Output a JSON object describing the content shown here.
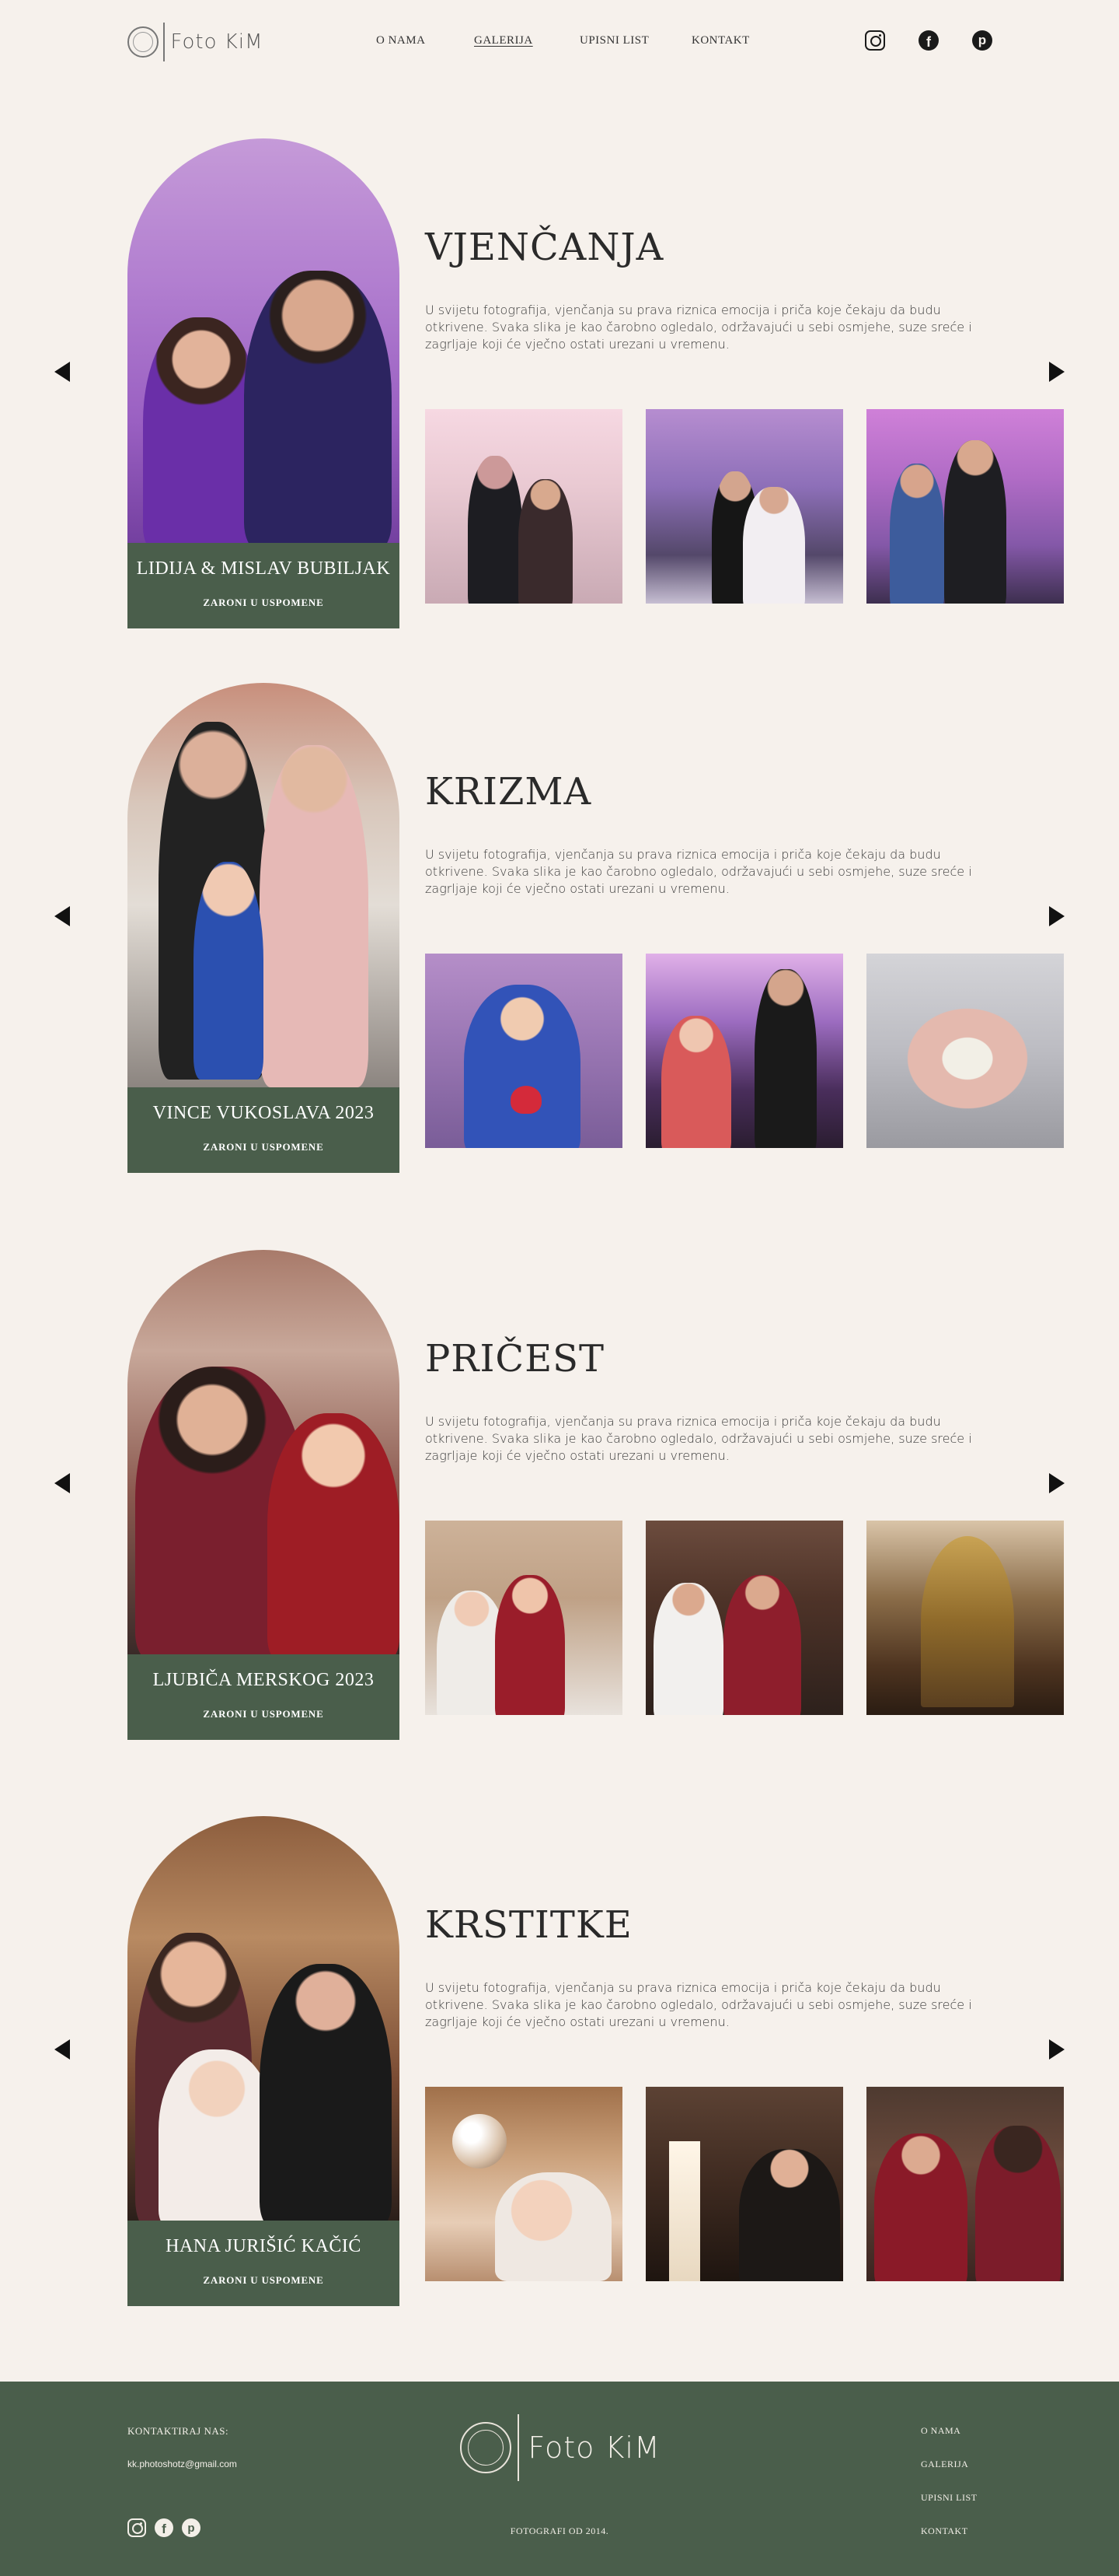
{
  "brand": {
    "name": "Foto KiM"
  },
  "nav": {
    "items": [
      "O NAMA",
      "GALERIJA",
      "UPISNI LIST",
      "KONTAKT"
    ],
    "active": "GALERIJA"
  },
  "social": [
    "instagram-icon",
    "facebook-icon",
    "pinterest-icon"
  ],
  "sections": [
    {
      "title": "VJENČANJA",
      "text": "U svijetu fotografija, vjenčanja su prava riznica emocija i priča koje čekaju da budu otkrivene. Svaka slika je kao čarobno ogledalo, održavajući u sebi osmjehe, suze sreće i zagrljaje koji će vječno ostati urezani u vremenu.",
      "featured": "LIDIJA & MISLAV BUBILJAK",
      "cta": "ZARONI U USPOMENE"
    },
    {
      "title": "KRIZMA",
      "text": "U svijetu fotografija, vjenčanja su prava riznica emocija i priča koje čekaju da budu otkrivene. Svaka slika je kao čarobno ogledalo, održavajući u sebi osmjehe, suze sreće i zagrljaje koji će vječno ostati urezani u vremenu.",
      "featured": "VINCE VUKOSLAVA 2023",
      "cta": "ZARONI U USPOMENE"
    },
    {
      "title": "PRIČEST",
      "text": "U svijetu fotografija, vjenčanja su prava riznica emocija i priča koje čekaju da budu otkrivene. Svaka slika je kao čarobno ogledalo, održavajući u sebi osmjehe, suze sreće i zagrljaje koji će vječno ostati urezani u vremenu.",
      "featured": "LJUBIČA MERSKOG 2023",
      "cta": "ZARONI U USPOMENE"
    },
    {
      "title": "KRSTITKE",
      "text": "U svijetu fotografija, vjenčanja su prava riznica emocija i priča koje čekaju da budu otkrivene. Svaka slika je kao čarobno ogledalo, održavajući u sebi osmjehe, suze sreće i zagrljaje koji će vječno ostati urezani u vremenu.",
      "featured": "HANA JURIŠIĆ KAČIĆ",
      "cta": "ZARONI U USPOMENE"
    }
  ],
  "footer": {
    "contact_label": "KONTAKTIRAJ NAS:",
    "email": "kk.photoshotz@gmail.com",
    "since": "FOTOGRAFI OD 2014.",
    "nav": [
      "O NAMA",
      "GALERIJA",
      "UPISNI LIST",
      "KONTAKT"
    ]
  },
  "colors": {
    "accent": "#4a5e4b",
    "background": "#f6f1ec",
    "text": "#2b2b2b"
  }
}
